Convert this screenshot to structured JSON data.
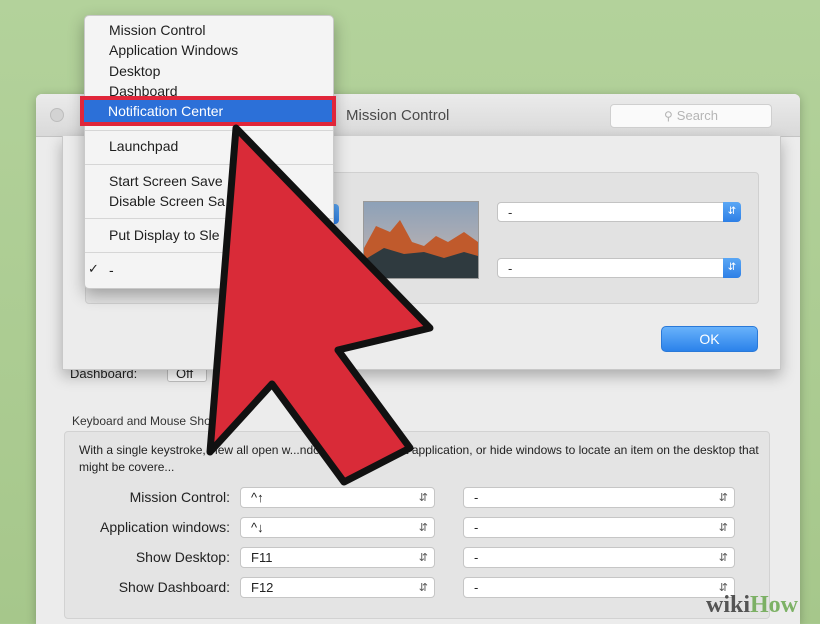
{
  "window": {
    "title": "Mission Control",
    "search_placeholder": "Search"
  },
  "menu": {
    "items": [
      "Mission Control",
      "Application Windows",
      "Desktop",
      "Dashboard",
      "Notification Center",
      "Launchpad",
      "Start Screen Save",
      "Disable Screen Sa",
      "Put Display to Sle",
      "-"
    ],
    "selected": "Notification Center",
    "checked_mark": "✓"
  },
  "sheet": {
    "top_right_value": "-",
    "bottom_right_value": "-",
    "ok_label": "OK"
  },
  "dashboard": {
    "label": "Dashboard:",
    "value": "Off"
  },
  "shortcuts": {
    "header": "Keyboard and Mouse Shortcuts",
    "description": "With a single keystroke, view all open w...ndows of the current application, or hide windows to locate an item on the desktop that might be covere...",
    "rows": [
      {
        "label": "Mission Control:",
        "key": "^↑",
        "modifier": "-"
      },
      {
        "label": "Application windows:",
        "key": "^↓",
        "modifier": "-"
      },
      {
        "label": "Show Desktop:",
        "key": "F11",
        "modifier": "-"
      },
      {
        "label": "Show Dashboard:",
        "key": "F12",
        "modifier": "-"
      }
    ]
  },
  "watermark": {
    "wiki": "wiki",
    "how": "How"
  },
  "colors": {
    "background": "#a8c98f",
    "menu_highlight": "#2c70d8",
    "callout_red": "#e0263a",
    "button_blue": "#2b82ea"
  },
  "icons": [
    "search-icon",
    "chevron-updown-icon",
    "checkmark-icon",
    "arrow-pointer-icon"
  ]
}
